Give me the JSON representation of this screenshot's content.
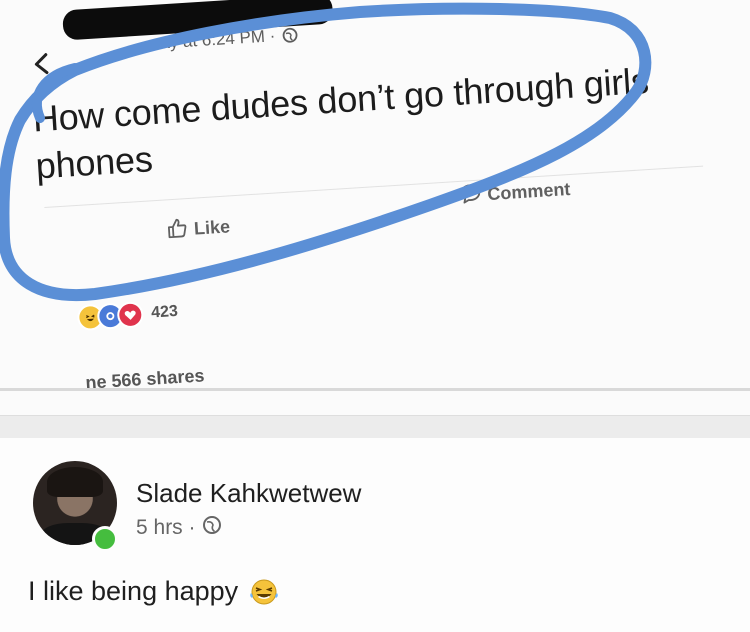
{
  "post": {
    "timestamp": "ay at 6:24 PM ·",
    "text": "How come dudes don’t go through girls phones",
    "like_label": "Like",
    "comment_label": "Comment",
    "reaction_count": "423",
    "shares": "ne 566 shares",
    "icons": {
      "back": "back-chevron-icon",
      "privacy": "globe-icon",
      "like": "thumbs-up-icon",
      "comment": "speech-bubble-icon",
      "reactions": [
        "haha-reaction-icon",
        "wow-reaction-icon",
        "love-reaction-icon"
      ]
    }
  },
  "comment_post": {
    "author": "Slade Kahkwetwew",
    "time": "5 hrs ·",
    "text": "I like being happy",
    "icons": {
      "avatar": "avatar",
      "online": "online-status-icon",
      "privacy": "globe-icon",
      "emoji": "laughing-emoji-icon"
    }
  },
  "colors": {
    "annotation_blue": "#5b8fd6",
    "online_green": "#45bd3e",
    "text_dark": "#1f1f1f",
    "text_muted": "#606060"
  }
}
